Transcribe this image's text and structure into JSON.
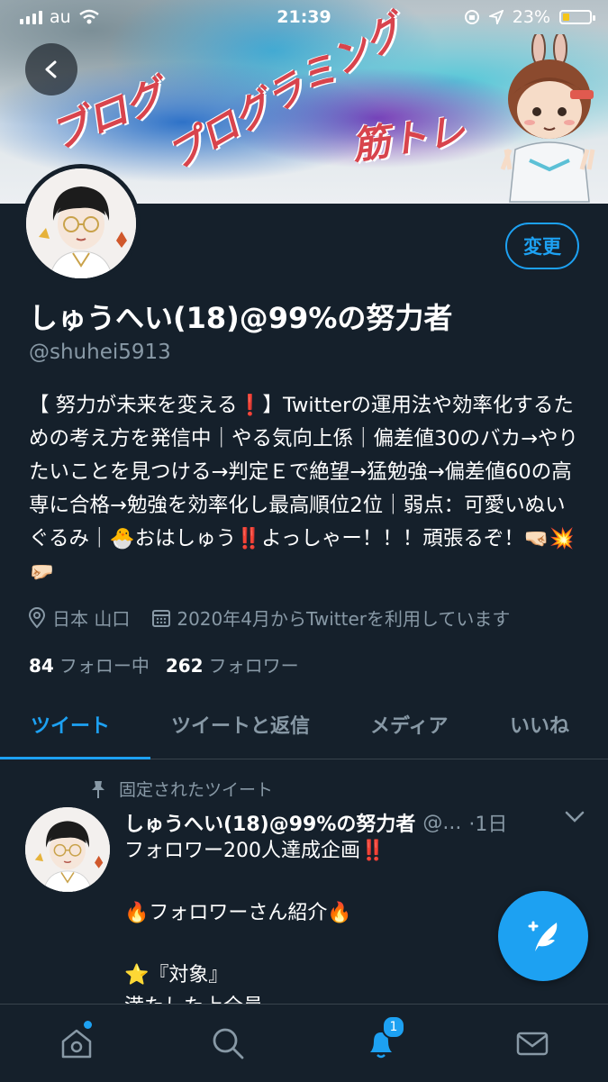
{
  "status_bar": {
    "carrier": "au",
    "time": "21:39",
    "battery_percent": "23%"
  },
  "banner": {
    "text_1": "ブログ",
    "text_2": "プログラミング",
    "text_3": "筋トレ"
  },
  "profile": {
    "edit_label": "変更",
    "display_name": "しゅうへい(18)@99%の努力者",
    "handle": "@shuhei5913",
    "bio": "【 努力が未来を変える❗️】Twitterの運用法や効率化するための考え方を発信中｜やる気向上係｜偏差値30のバカ→やりたいことを見つける→判定Ｅで絶望→猛勉強→偏差値60の高専に合格→勉強を効率化し最高順位2位｜弱点：可愛いぬいぐるみ｜🐣おはしゅう‼️よっしゃー！！！頑張るぞ！🤜🏻💥🤛🏻",
    "location": "日本 山口",
    "joined": "2020年4月からTwitterを利用しています",
    "following_count": "84",
    "following_label": "フォロー中",
    "followers_count": "262",
    "followers_label": "フォロワー"
  },
  "tabs": [
    {
      "label": "ツイート",
      "active": true
    },
    {
      "label": "ツイートと返信",
      "active": false
    },
    {
      "label": "メディア",
      "active": false
    },
    {
      "label": "いいね",
      "active": false
    }
  ],
  "pinned_tweet": {
    "pinned_label": "固定されたツイート",
    "author_name": "しゅうへい(18)@99%の努力者",
    "author_handle": "@...",
    "time": "·1日",
    "body": "フォロワー200人達成企画‼️\n\n🔥フォロワーさん紹介🔥\n\n⭐️『対象』\n満たした上全員"
  },
  "bottom_nav": {
    "notification_badge": "1"
  },
  "colors": {
    "background": "#15202b",
    "accent": "#1da1f2",
    "secondary_text": "#8899a6",
    "divider": "#38444d"
  },
  "icons": [
    "back-arrow-icon",
    "location-pin-icon",
    "calendar-icon",
    "pin-icon",
    "chevron-down-icon",
    "compose-feather-icon",
    "home-icon",
    "search-icon",
    "bell-icon",
    "mail-icon"
  ]
}
